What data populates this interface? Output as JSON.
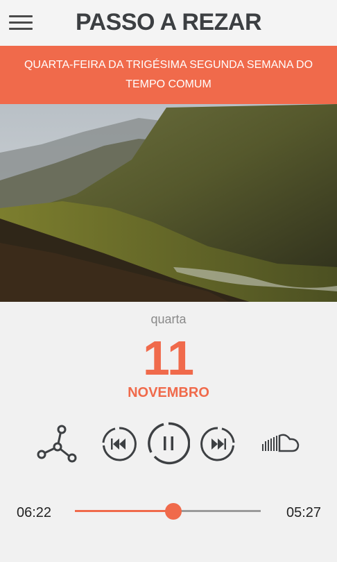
{
  "header": {
    "title": "PASSO A REZAR",
    "menu_icon": "hamburger-menu-icon"
  },
  "banner": {
    "text": "QUARTA-FEIRA DA TRIGÉSIMA SEGUNDA SEMANA DO TEMPO COMUM"
  },
  "date": {
    "weekday": "quarta",
    "day": "11",
    "month": "NOVEMBRO"
  },
  "controls": {
    "share_icon": "share-icon",
    "rewind_icon": "rewind-icon",
    "play_pause_icon": "pause-icon",
    "forward_icon": "fast-forward-icon",
    "soundcloud_icon": "soundcloud-icon"
  },
  "player": {
    "elapsed": "06:22",
    "remaining": "05:27",
    "progress": 0.53
  },
  "colors": {
    "accent": "#f06a4b",
    "title": "#3c3f42",
    "icon": "#3d4043"
  }
}
